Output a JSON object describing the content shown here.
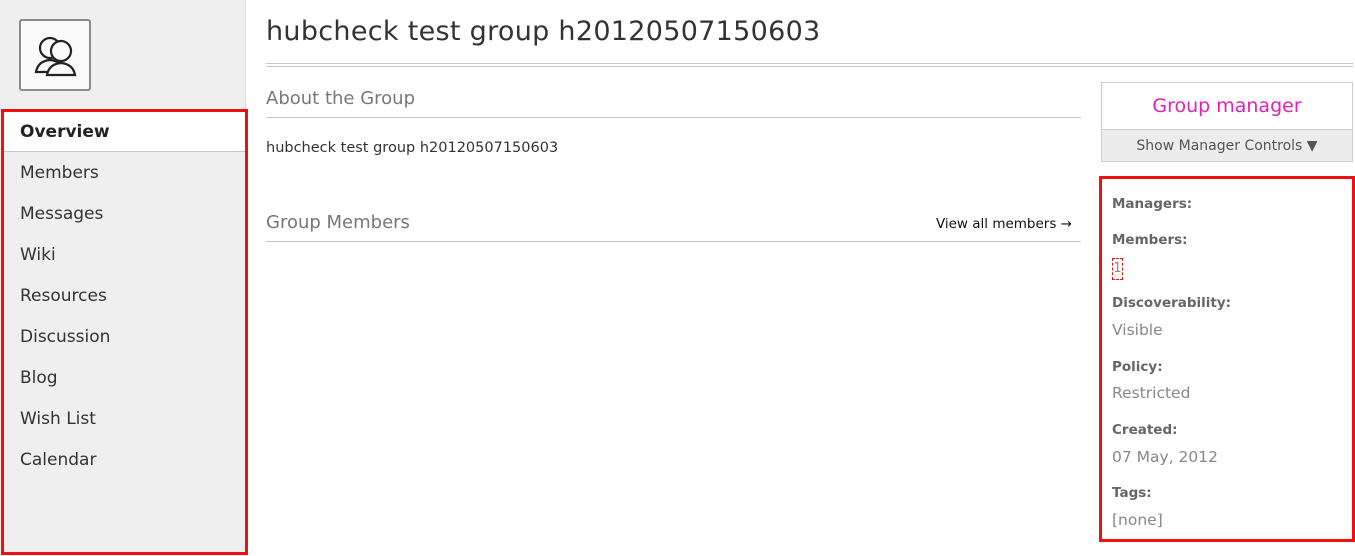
{
  "sidebar": {
    "avatar_icon": "group-users-icon",
    "items": [
      {
        "label": "Overview",
        "active": true
      },
      {
        "label": "Members"
      },
      {
        "label": "Messages"
      },
      {
        "label": "Wiki"
      },
      {
        "label": "Resources"
      },
      {
        "label": "Discussion"
      },
      {
        "label": "Blog"
      },
      {
        "label": "Wish List"
      },
      {
        "label": "Calendar"
      }
    ]
  },
  "main": {
    "title": "hubcheck test group h20120507150603",
    "about": {
      "heading": "About the Group",
      "text": "hubcheck test group h20120507150603"
    },
    "members_section": {
      "heading": "Group Members",
      "view_all": "View all members →"
    }
  },
  "manager": {
    "title": "Group manager",
    "controls_label": "Show Manager Controls ▼"
  },
  "info": {
    "managers_label": "Managers:",
    "members_label": "Members:",
    "members_value": "1",
    "discoverability_label": "Discoverability:",
    "discoverability_value": "Visible",
    "policy_label": "Policy:",
    "policy_value": "Restricted",
    "created_label": "Created:",
    "created_value": "07 May, 2012",
    "tags_label": "Tags:",
    "tags_value": "[none]"
  },
  "colors": {
    "highlight_border": "#ee1111",
    "manager_title": "#e020b8"
  }
}
